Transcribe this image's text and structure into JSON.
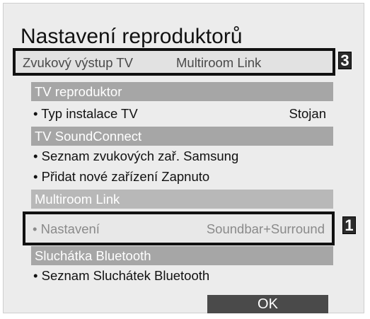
{
  "screen_title": "Nastavení reproduktorů",
  "tabs": [
    {
      "label": "Zvukový výstup TV"
    },
    {
      "label": "Multiroom Link"
    }
  ],
  "callouts": {
    "top": "3",
    "row": "1"
  },
  "sections": {
    "tv_speaker": {
      "header": "TV reproduktor",
      "items": [
        {
          "label": "• Typ instalace TV",
          "value": "Stojan"
        }
      ]
    },
    "soundconnect": {
      "header": "TV SoundConnect",
      "items": [
        {
          "label": "• Seznam zvukových zař. Samsung"
        },
        {
          "label": "• Přidat nové zařízení Zapnuto"
        }
      ]
    },
    "multiroom": {
      "header": "Multiroom Link",
      "items": [
        {
          "label": "• Nastavení",
          "value": "Soundbar+Surround"
        }
      ]
    },
    "bluetooth": {
      "header": "Sluchátka Bluetooth",
      "items": [
        {
          "label": "• Seznam Sluchátek Bluetooth"
        }
      ]
    }
  },
  "ok_label": "OK",
  "colors": {
    "panel_bg": "#ececec",
    "section_header_bg": "#a6a6a6",
    "highlight_border": "#111111",
    "ok_button_bg": "#4a4a4a",
    "callout_bg": "#2b2b2b"
  }
}
